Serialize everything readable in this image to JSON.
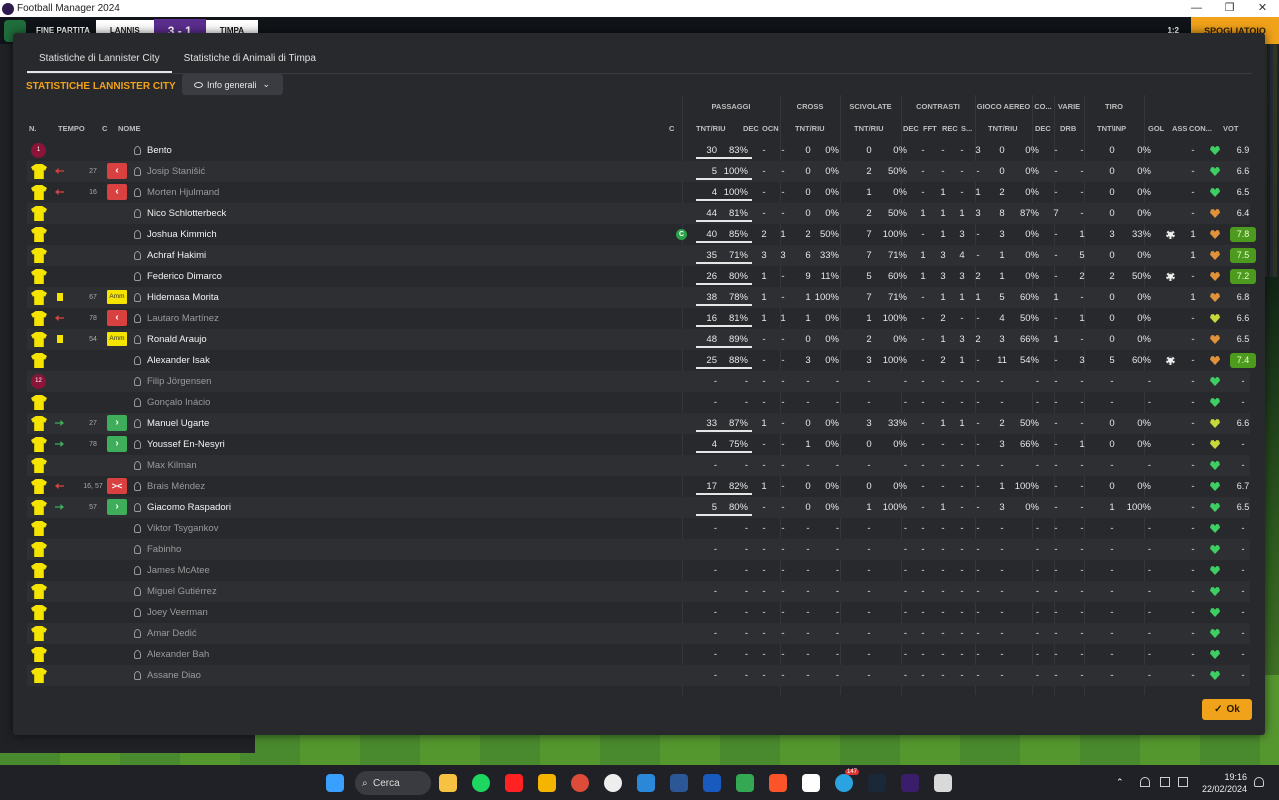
{
  "window": {
    "title": "Football Manager 2024",
    "min": "—",
    "max": "❐",
    "close": "✕"
  },
  "matchbar": {
    "label": "FINE PARTITA",
    "home": "LANNIS",
    "score": "3 - 1",
    "away": "TIMPA",
    "proceed": "SPOGLIATOIO",
    "time_label": "1:2"
  },
  "tabs": [
    {
      "label": "Statistiche di Lannister City",
      "active": true
    },
    {
      "label": "Statistiche di Animali di Timpa",
      "active": false
    }
  ],
  "section_title": "STATISTICHE LANNISTER CITY",
  "view_dropdown": "Info generali",
  "groups": {
    "passaggi": "PASSAGGI",
    "cross": "CROSS",
    "scivolate": "SCIVOLATE",
    "contrasti": "CONTRASTI",
    "aereo": "GIOCO AEREO",
    "co": "CO...",
    "varie": "VARIE",
    "tiro": "TIRO"
  },
  "columns": {
    "n": "N.",
    "tempo": "TEMPO",
    "c": "C",
    "nome": "NOME",
    "cap": "C",
    "pass": "TNT/RIU",
    "dec": "DEC",
    "ocn": "OCN",
    "cross": "TNT/RIU",
    "sciv": "TNT/RIU",
    "cdec": "DEC",
    "fft": "FFT",
    "rec": "REC",
    "s": "S...",
    "aereo": "TNT/RIU",
    "codec": "DEC",
    "drb": "DRB",
    "tiro": "TNT\\INP",
    "gol": "GOL",
    "ass": "ASS",
    "con": "CON...",
    "voto": "VOT"
  },
  "players": [
    {
      "num": "1",
      "kit": "gk",
      "time": "",
      "sub": "",
      "yellow": false,
      "amm": false,
      "name": "Bento",
      "active": true,
      "cap": false,
      "pt": "30",
      "pp": "83%",
      "dec": "-",
      "ocn": "-",
      "ct": "0",
      "cp": "0%",
      "st": "0",
      "sp": "0%",
      "d": "-",
      "f": "-",
      "r": "-",
      "s": "3",
      "at": "0",
      "ap": "0%",
      "cd": "-",
      "drb": "-",
      "tt": "0",
      "tp": "0%",
      "gol": "",
      "ass": "-",
      "heart": "green",
      "vote": "6.9",
      "hi": false
    },
    {
      "num": "",
      "kit": "shirt",
      "time": "27",
      "sub": "out",
      "yellow": false,
      "amm": false,
      "name": "Josip Stanišić",
      "active": false,
      "cap": false,
      "pt": "5",
      "pp": "100%",
      "dec": "-",
      "ocn": "-",
      "ct": "0",
      "cp": "0%",
      "st": "2",
      "sp": "50%",
      "d": "-",
      "f": "-",
      "r": "-",
      "s": "-",
      "at": "0",
      "ap": "0%",
      "cd": "-",
      "drb": "-",
      "tt": "0",
      "tp": "0%",
      "gol": "",
      "ass": "-",
      "heart": "green",
      "vote": "6.6",
      "hi": false
    },
    {
      "num": "",
      "kit": "shirt",
      "time": "16",
      "sub": "out",
      "yellow": false,
      "amm": false,
      "name": "Morten Hjulmand",
      "active": false,
      "cap": false,
      "pt": "4",
      "pp": "100%",
      "dec": "-",
      "ocn": "-",
      "ct": "0",
      "cp": "0%",
      "st": "1",
      "sp": "0%",
      "d": "-",
      "f": "1",
      "r": "-",
      "s": "1",
      "at": "2",
      "ap": "0%",
      "cd": "-",
      "drb": "-",
      "tt": "0",
      "tp": "0%",
      "gol": "",
      "ass": "-",
      "heart": "green",
      "vote": "6.5",
      "hi": false
    },
    {
      "num": "",
      "kit": "shirt",
      "time": "",
      "sub": "",
      "yellow": false,
      "amm": false,
      "name": "Nico Schlotterbeck",
      "active": true,
      "cap": false,
      "pt": "44",
      "pp": "81%",
      "dec": "-",
      "ocn": "-",
      "ct": "0",
      "cp": "0%",
      "st": "2",
      "sp": "50%",
      "d": "1",
      "f": "1",
      "r": "1",
      "s": "3",
      "at": "8",
      "ap": "87%",
      "cd": "7",
      "drb": "-",
      "tt": "0",
      "tp": "0%",
      "gol": "",
      "ass": "-",
      "heart": "orange",
      "vote": "6.4",
      "hi": false
    },
    {
      "num": "",
      "kit": "shirt",
      "time": "",
      "sub": "",
      "yellow": false,
      "amm": false,
      "name": "Joshua Kimmich",
      "active": true,
      "cap": true,
      "pt": "40",
      "pp": "85%",
      "dec": "2",
      "ocn": "1",
      "ct": "2",
      "cp": "50%",
      "st": "7",
      "sp": "100%",
      "d": "-",
      "f": "1",
      "r": "3",
      "s": "-",
      "at": "3",
      "ap": "0%",
      "cd": "-",
      "drb": "1",
      "tt": "3",
      "tp": "33%",
      "gol": "ball",
      "ass": "1",
      "heart": "orange",
      "vote": "7.8",
      "hi": true
    },
    {
      "num": "",
      "kit": "shirt",
      "time": "",
      "sub": "",
      "yellow": false,
      "amm": false,
      "name": "Achraf Hakimi",
      "active": true,
      "cap": false,
      "pt": "35",
      "pp": "71%",
      "dec": "3",
      "ocn": "3",
      "ct": "6",
      "cp": "33%",
      "st": "7",
      "sp": "71%",
      "d": "1",
      "f": "3",
      "r": "4",
      "s": "-",
      "at": "1",
      "ap": "0%",
      "cd": "-",
      "drb": "5",
      "tt": "0",
      "tp": "0%",
      "gol": "",
      "ass": "1",
      "heart": "orange",
      "vote": "7.5",
      "hi": true
    },
    {
      "num": "",
      "kit": "shirt",
      "time": "",
      "sub": "",
      "yellow": false,
      "amm": false,
      "name": "Federico Dimarco",
      "active": true,
      "cap": false,
      "pt": "26",
      "pp": "80%",
      "dec": "1",
      "ocn": "-",
      "ct": "9",
      "cp": "11%",
      "st": "5",
      "sp": "60%",
      "d": "1",
      "f": "3",
      "r": "3",
      "s": "2",
      "at": "1",
      "ap": "0%",
      "cd": "-",
      "drb": "2",
      "tt": "2",
      "tp": "50%",
      "gol": "ball",
      "ass": "-",
      "heart": "orange",
      "vote": "7.2",
      "hi": true
    },
    {
      "num": "",
      "kit": "shirt",
      "time": "67",
      "sub": "",
      "yellow": true,
      "amm": true,
      "name": "Hidemasa Morita",
      "active": true,
      "cap": false,
      "pt": "38",
      "pp": "78%",
      "dec": "1",
      "ocn": "-",
      "ct": "1",
      "cp": "100%",
      "st": "7",
      "sp": "71%",
      "d": "-",
      "f": "1",
      "r": "1",
      "s": "1",
      "at": "5",
      "ap": "60%",
      "cd": "1",
      "drb": "-",
      "tt": "0",
      "tp": "0%",
      "gol": "",
      "ass": "1",
      "heart": "orange",
      "vote": "6.8",
      "hi": false
    },
    {
      "num": "",
      "kit": "shirt",
      "time": "78",
      "sub": "out",
      "yellow": false,
      "amm": false,
      "name": "Lautaro Martínez",
      "active": false,
      "cap": false,
      "pt": "16",
      "pp": "81%",
      "dec": "1",
      "ocn": "1",
      "ct": "1",
      "cp": "0%",
      "st": "1",
      "sp": "100%",
      "d": "-",
      "f": "2",
      "r": "-",
      "s": "-",
      "at": "4",
      "ap": "50%",
      "cd": "-",
      "drb": "1",
      "tt": "0",
      "tp": "0%",
      "gol": "",
      "ass": "-",
      "heart": "yellow",
      "vote": "6.6",
      "hi": false
    },
    {
      "num": "",
      "kit": "shirt",
      "time": "54",
      "sub": "",
      "yellow": true,
      "amm": true,
      "name": "Ronald Araujo",
      "active": true,
      "cap": false,
      "pt": "48",
      "pp": "89%",
      "dec": "-",
      "ocn": "-",
      "ct": "0",
      "cp": "0%",
      "st": "2",
      "sp": "0%",
      "d": "-",
      "f": "1",
      "r": "3",
      "s": "2",
      "at": "3",
      "ap": "66%",
      "cd": "1",
      "drb": "-",
      "tt": "0",
      "tp": "0%",
      "gol": "",
      "ass": "-",
      "heart": "orange",
      "vote": "6.5",
      "hi": false
    },
    {
      "num": "",
      "kit": "shirt",
      "time": "",
      "sub": "",
      "yellow": false,
      "amm": false,
      "name": "Alexander Isak",
      "active": true,
      "cap": false,
      "pt": "25",
      "pp": "88%",
      "dec": "-",
      "ocn": "-",
      "ct": "3",
      "cp": "0%",
      "st": "3",
      "sp": "100%",
      "d": "-",
      "f": "2",
      "r": "1",
      "s": "-",
      "at": "11",
      "ap": "54%",
      "cd": "-",
      "drb": "3",
      "tt": "5",
      "tp": "60%",
      "gol": "ball",
      "ass": "-",
      "heart": "orange",
      "vote": "7.4",
      "hi": true
    },
    {
      "num": "12",
      "kit": "gk",
      "time": "",
      "sub": "",
      "yellow": false,
      "amm": false,
      "name": "Filip Jörgensen",
      "active": false,
      "cap": false,
      "pt": "-",
      "pp": "-",
      "dec": "-",
      "ocn": "-",
      "ct": "-",
      "cp": "-",
      "st": "-",
      "sp": "-",
      "d": "-",
      "f": "-",
      "r": "-",
      "s": "-",
      "at": "-",
      "ap": "-",
      "cd": "-",
      "drb": "-",
      "tt": "-",
      "tp": "-",
      "gol": "",
      "ass": "-",
      "heart": "green",
      "vote": "-",
      "hi": false
    },
    {
      "num": "",
      "kit": "shirt",
      "time": "",
      "sub": "",
      "yellow": false,
      "amm": false,
      "name": "Gonçalo Inácio",
      "active": false,
      "cap": false,
      "pt": "-",
      "pp": "-",
      "dec": "-",
      "ocn": "-",
      "ct": "-",
      "cp": "-",
      "st": "-",
      "sp": "-",
      "d": "-",
      "f": "-",
      "r": "-",
      "s": "-",
      "at": "-",
      "ap": "-",
      "cd": "-",
      "drb": "-",
      "tt": "-",
      "tp": "-",
      "gol": "",
      "ass": "-",
      "heart": "green",
      "vote": "-",
      "hi": false
    },
    {
      "num": "",
      "kit": "shirt",
      "time": "27",
      "sub": "in",
      "yellow": false,
      "amm": false,
      "name": "Manuel Ugarte",
      "active": true,
      "cap": false,
      "pt": "33",
      "pp": "87%",
      "dec": "1",
      "ocn": "-",
      "ct": "0",
      "cp": "0%",
      "st": "3",
      "sp": "33%",
      "d": "-",
      "f": "1",
      "r": "1",
      "s": "-",
      "at": "2",
      "ap": "50%",
      "cd": "-",
      "drb": "-",
      "tt": "0",
      "tp": "0%",
      "gol": "",
      "ass": "-",
      "heart": "yellow",
      "vote": "6.6",
      "hi": false
    },
    {
      "num": "",
      "kit": "shirt",
      "time": "78",
      "sub": "in",
      "yellow": false,
      "amm": false,
      "name": "Youssef En-Nesyri",
      "active": true,
      "cap": false,
      "pt": "4",
      "pp": "75%",
      "dec": "-",
      "ocn": "-",
      "ct": "1",
      "cp": "0%",
      "st": "0",
      "sp": "0%",
      "d": "-",
      "f": "-",
      "r": "-",
      "s": "-",
      "at": "3",
      "ap": "66%",
      "cd": "-",
      "drb": "1",
      "tt": "0",
      "tp": "0%",
      "gol": "",
      "ass": "-",
      "heart": "yellow",
      "vote": "-",
      "hi": false
    },
    {
      "num": "",
      "kit": "shirt",
      "time": "",
      "sub": "",
      "yellow": false,
      "amm": false,
      "name": "Max Kilman",
      "active": false,
      "cap": false,
      "pt": "-",
      "pp": "-",
      "dec": "-",
      "ocn": "-",
      "ct": "-",
      "cp": "-",
      "st": "-",
      "sp": "-",
      "d": "-",
      "f": "-",
      "r": "-",
      "s": "-",
      "at": "-",
      "ap": "-",
      "cd": "-",
      "drb": "-",
      "tt": "-",
      "tp": "-",
      "gol": "",
      "ass": "-",
      "heart": "green",
      "vote": "-",
      "hi": false
    },
    {
      "num": "",
      "kit": "shirt",
      "time": "16, 57",
      "sub": "inout",
      "yellow": false,
      "amm": false,
      "name": "Brais Méndez",
      "active": false,
      "cap": false,
      "pt": "17",
      "pp": "82%",
      "dec": "1",
      "ocn": "-",
      "ct": "0",
      "cp": "0%",
      "st": "0",
      "sp": "0%",
      "d": "-",
      "f": "-",
      "r": "-",
      "s": "-",
      "at": "1",
      "ap": "100%",
      "cd": "-",
      "drb": "-",
      "tt": "0",
      "tp": "0%",
      "gol": "",
      "ass": "-",
      "heart": "green",
      "vote": "6.7",
      "hi": false
    },
    {
      "num": "",
      "kit": "shirt",
      "time": "57",
      "sub": "in",
      "yellow": false,
      "amm": false,
      "name": "Giacomo Raspadori",
      "active": true,
      "cap": false,
      "pt": "5",
      "pp": "80%",
      "dec": "-",
      "ocn": "-",
      "ct": "0",
      "cp": "0%",
      "st": "1",
      "sp": "100%",
      "d": "-",
      "f": "1",
      "r": "-",
      "s": "-",
      "at": "3",
      "ap": "0%",
      "cd": "-",
      "drb": "-",
      "tt": "1",
      "tp": "100%",
      "gol": "",
      "ass": "-",
      "heart": "green",
      "vote": "6.5",
      "hi": false
    },
    {
      "num": "",
      "kit": "shirt",
      "time": "",
      "sub": "",
      "yellow": false,
      "amm": false,
      "name": "Viktor Tsygankov",
      "active": false,
      "cap": false,
      "pt": "-",
      "pp": "-",
      "dec": "-",
      "ocn": "-",
      "ct": "-",
      "cp": "-",
      "st": "-",
      "sp": "-",
      "d": "-",
      "f": "-",
      "r": "-",
      "s": "-",
      "at": "-",
      "ap": "-",
      "cd": "-",
      "drb": "-",
      "tt": "-",
      "tp": "-",
      "gol": "",
      "ass": "-",
      "heart": "green",
      "vote": "-",
      "hi": false
    },
    {
      "num": "",
      "kit": "shirt",
      "time": "",
      "sub": "",
      "yellow": false,
      "amm": false,
      "name": "Fabinho",
      "active": false,
      "cap": false,
      "pt": "-",
      "pp": "-",
      "dec": "-",
      "ocn": "-",
      "ct": "-",
      "cp": "-",
      "st": "-",
      "sp": "-",
      "d": "-",
      "f": "-",
      "r": "-",
      "s": "-",
      "at": "-",
      "ap": "-",
      "cd": "-",
      "drb": "-",
      "tt": "-",
      "tp": "-",
      "gol": "",
      "ass": "-",
      "heart": "green",
      "vote": "-",
      "hi": false
    },
    {
      "num": "",
      "kit": "shirt",
      "time": "",
      "sub": "",
      "yellow": false,
      "amm": false,
      "name": "James McAtee",
      "active": false,
      "cap": false,
      "pt": "-",
      "pp": "-",
      "dec": "-",
      "ocn": "-",
      "ct": "-",
      "cp": "-",
      "st": "-",
      "sp": "-",
      "d": "-",
      "f": "-",
      "r": "-",
      "s": "-",
      "at": "-",
      "ap": "-",
      "cd": "-",
      "drb": "-",
      "tt": "-",
      "tp": "-",
      "gol": "",
      "ass": "-",
      "heart": "green",
      "vote": "-",
      "hi": false
    },
    {
      "num": "",
      "kit": "shirt",
      "time": "",
      "sub": "",
      "yellow": false,
      "amm": false,
      "name": "Miguel Gutiérrez",
      "active": false,
      "cap": false,
      "pt": "-",
      "pp": "-",
      "dec": "-",
      "ocn": "-",
      "ct": "-",
      "cp": "-",
      "st": "-",
      "sp": "-",
      "d": "-",
      "f": "-",
      "r": "-",
      "s": "-",
      "at": "-",
      "ap": "-",
      "cd": "-",
      "drb": "-",
      "tt": "-",
      "tp": "-",
      "gol": "",
      "ass": "-",
      "heart": "green",
      "vote": "-",
      "hi": false
    },
    {
      "num": "",
      "kit": "shirt",
      "time": "",
      "sub": "",
      "yellow": false,
      "amm": false,
      "name": "Joey Veerman",
      "active": false,
      "cap": false,
      "pt": "-",
      "pp": "-",
      "dec": "-",
      "ocn": "-",
      "ct": "-",
      "cp": "-",
      "st": "-",
      "sp": "-",
      "d": "-",
      "f": "-",
      "r": "-",
      "s": "-",
      "at": "-",
      "ap": "-",
      "cd": "-",
      "drb": "-",
      "tt": "-",
      "tp": "-",
      "gol": "",
      "ass": "-",
      "heart": "green",
      "vote": "-",
      "hi": false
    },
    {
      "num": "",
      "kit": "shirt",
      "time": "",
      "sub": "",
      "yellow": false,
      "amm": false,
      "name": "Amar Dedić",
      "active": false,
      "cap": false,
      "pt": "-",
      "pp": "-",
      "dec": "-",
      "ocn": "-",
      "ct": "-",
      "cp": "-",
      "st": "-",
      "sp": "-",
      "d": "-",
      "f": "-",
      "r": "-",
      "s": "-",
      "at": "-",
      "ap": "-",
      "cd": "-",
      "drb": "-",
      "tt": "-",
      "tp": "-",
      "gol": "",
      "ass": "-",
      "heart": "green",
      "vote": "-",
      "hi": false
    },
    {
      "num": "",
      "kit": "shirt",
      "time": "",
      "sub": "",
      "yellow": false,
      "amm": false,
      "name": "Alexander Bah",
      "active": false,
      "cap": false,
      "pt": "-",
      "pp": "-",
      "dec": "-",
      "ocn": "-",
      "ct": "-",
      "cp": "-",
      "st": "-",
      "sp": "-",
      "d": "-",
      "f": "-",
      "r": "-",
      "s": "-",
      "at": "-",
      "ap": "-",
      "cd": "-",
      "drb": "-",
      "tt": "-",
      "tp": "-",
      "gol": "",
      "ass": "-",
      "heart": "green",
      "vote": "-",
      "hi": false
    },
    {
      "num": "",
      "kit": "shirt",
      "time": "",
      "sub": "",
      "yellow": false,
      "amm": false,
      "name": "Assane Diao",
      "active": false,
      "cap": false,
      "pt": "-",
      "pp": "-",
      "dec": "-",
      "ocn": "-",
      "ct": "-",
      "cp": "-",
      "st": "-",
      "sp": "-",
      "d": "-",
      "f": "-",
      "r": "-",
      "s": "-",
      "at": "-",
      "ap": "-",
      "cd": "-",
      "drb": "-",
      "tt": "-",
      "tp": "-",
      "gol": "",
      "ass": "-",
      "heart": "green",
      "vote": "-",
      "hi": false
    }
  ],
  "ok_button": "Ok",
  "taskbar": {
    "search": "Cerca",
    "time": "19:16",
    "date": "22/02/2024",
    "badge": "147"
  },
  "colors": {
    "accent": "#f0a21a",
    "shirt": "#f4e400",
    "gk": "#8a1538",
    "sub_in": "#3fae5a",
    "sub_out": "#d94141",
    "rating_hi": "#4c9a1e"
  }
}
